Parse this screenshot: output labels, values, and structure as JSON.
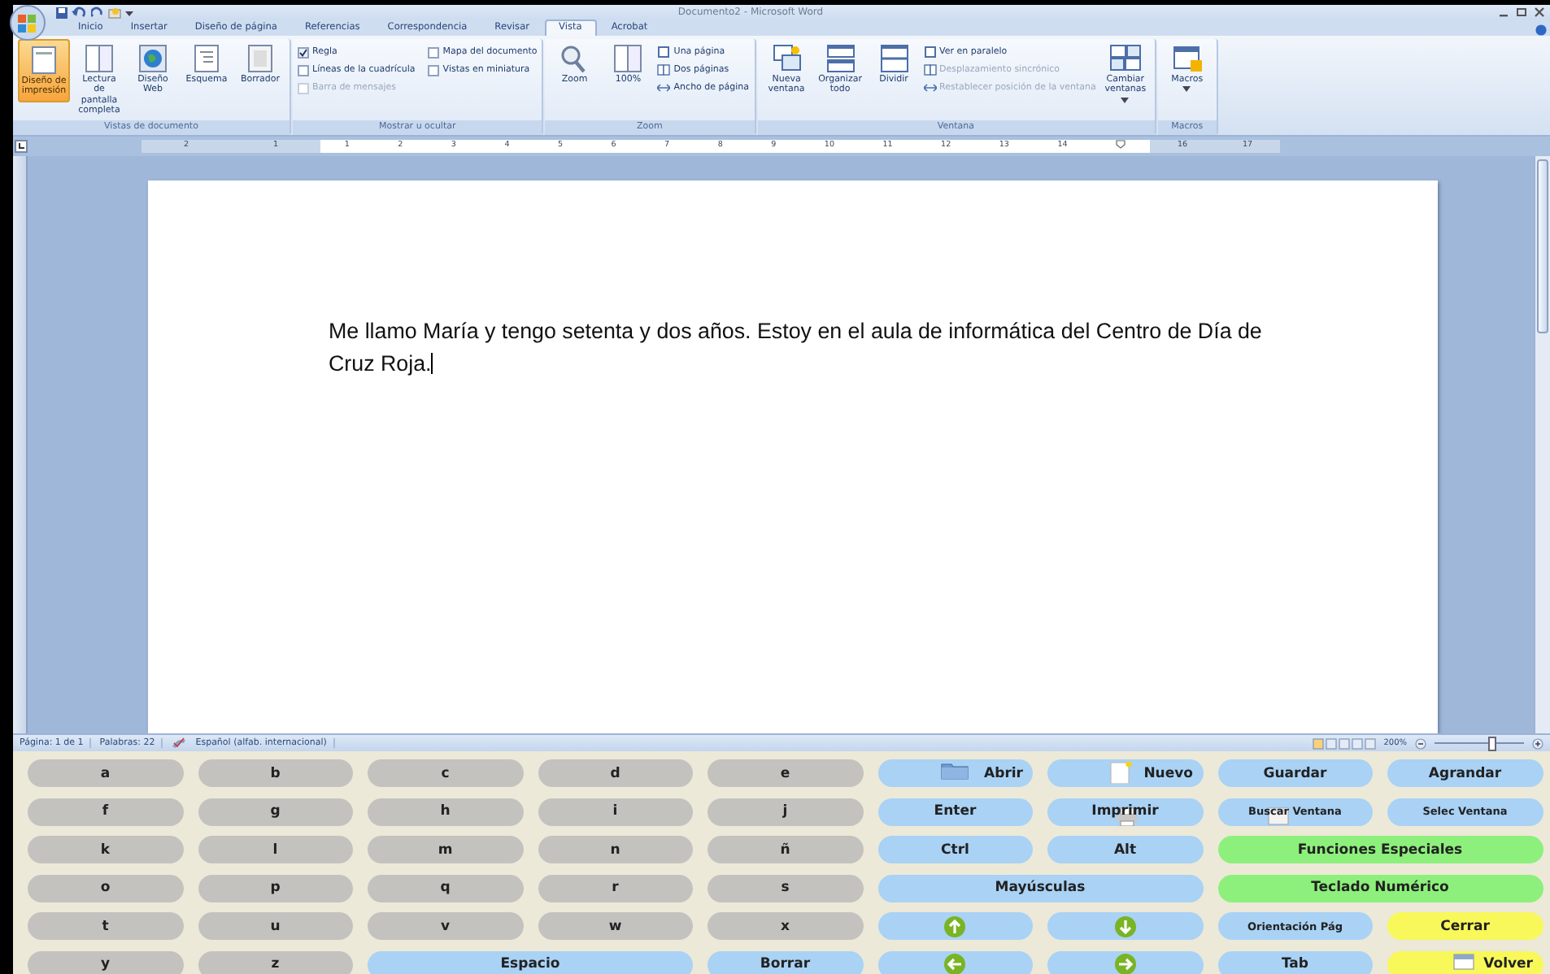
{
  "window": {
    "title": "Documento2 - Microsoft Word"
  },
  "tabs": [
    {
      "label": "Inicio",
      "selected": false
    },
    {
      "label": "Insertar",
      "selected": false
    },
    {
      "label": "Diseño de página",
      "selected": false
    },
    {
      "label": "Referencias",
      "selected": false
    },
    {
      "label": "Correspondencia",
      "selected": false
    },
    {
      "label": "Revisar",
      "selected": false
    },
    {
      "label": "Vista",
      "selected": true
    },
    {
      "label": "Acrobat",
      "selected": false
    }
  ],
  "ribbon": {
    "groups": [
      {
        "label": "Vistas de documento",
        "items": [
          {
            "kind": "large",
            "label": "Diseño de impresión",
            "selected": true
          },
          {
            "kind": "large",
            "label": "Lectura de pantalla completa",
            "selected": false
          },
          {
            "kind": "large",
            "label": "Diseño Web",
            "selected": false
          },
          {
            "kind": "large",
            "label": "Esquema",
            "selected": false
          },
          {
            "kind": "large",
            "label": "Borrador",
            "selected": false
          }
        ]
      },
      {
        "label": "Mostrar u ocultar",
        "items": [
          {
            "kind": "check",
            "label": "Regla",
            "checked": true,
            "disabled": false
          },
          {
            "kind": "check",
            "label": "Líneas de la cuadrícula",
            "checked": false,
            "disabled": false
          },
          {
            "kind": "check",
            "label": "Barra de mensajes",
            "checked": false,
            "disabled": true
          },
          {
            "kind": "check",
            "label": "Mapa del documento",
            "checked": false,
            "disabled": false
          },
          {
            "kind": "check",
            "label": "Vistas en miniatura",
            "checked": false,
            "disabled": false
          }
        ]
      },
      {
        "label": "Zoom",
        "items": [
          {
            "kind": "large",
            "label": "Zoom"
          },
          {
            "kind": "large",
            "label": "100%"
          },
          {
            "kind": "small",
            "label": "Una página",
            "disabled": false
          },
          {
            "kind": "small",
            "label": "Dos páginas",
            "disabled": false
          },
          {
            "kind": "small",
            "label": "Ancho de página",
            "disabled": false
          }
        ]
      },
      {
        "label": "Ventana",
        "items": [
          {
            "kind": "large",
            "label": "Nueva ventana"
          },
          {
            "kind": "large",
            "label": "Organizar todo"
          },
          {
            "kind": "large",
            "label": "Dividir"
          },
          {
            "kind": "small",
            "label": "Ver en paralelo",
            "disabled": false
          },
          {
            "kind": "small",
            "label": "Desplazamiento sincrónico",
            "disabled": true
          },
          {
            "kind": "small",
            "label": "Restablecer posición de la ventana",
            "disabled": true
          },
          {
            "kind": "dropdown",
            "label": "Cambiar ventanas"
          }
        ]
      },
      {
        "label": "Macros",
        "items": [
          {
            "kind": "dropdown",
            "label": "Macros"
          }
        ]
      }
    ]
  },
  "ruler": {
    "left_numbers": [
      "2",
      "1"
    ],
    "numbers": [
      "1",
      "2",
      "3",
      "4",
      "5",
      "6",
      "7",
      "8",
      "9",
      "10",
      "11",
      "12",
      "13",
      "14"
    ],
    "right_numbers": [
      "16",
      "17"
    ]
  },
  "document": {
    "paragraphs": [
      "Me llamo María y tengo setenta y dos años. Estoy en el aula de informática del Centro de Día de Cruz Roja."
    ]
  },
  "status_bar": {
    "pages": "Página: 1 de 1",
    "words": "Palabras: 22",
    "language": "Español (alfab. internacional)",
    "zoom": "200%",
    "zoom_slider": {
      "level": 0.62
    }
  },
  "keyboard": {
    "rows": [
      [
        {
          "label": "a",
          "color": "#c4c2bf"
        },
        {
          "label": "b",
          "color": "#c4c2bf"
        },
        {
          "label": "c",
          "color": "#c4c2bf"
        },
        {
          "label": "d",
          "color": "#c4c2bf"
        },
        {
          "label": "e",
          "color": "#c4c2bf"
        },
        {
          "kind": "open",
          "label": "Abrir",
          "color": "#a9d2f5"
        },
        {
          "kind": "new",
          "label": "Nuevo",
          "color": "#a9d2f5"
        },
        {
          "label": "Guardar",
          "color": "#a9d2f5"
        },
        {
          "label": "Agrandar",
          "color": "#a9d2f5"
        }
      ],
      [
        {
          "label": "f",
          "color": "#c4c2bf"
        },
        {
          "label": "g",
          "color": "#c4c2bf"
        },
        {
          "label": "h",
          "color": "#c4c2bf"
        },
        {
          "label": "i",
          "color": "#c4c2bf"
        },
        {
          "label": "j",
          "color": "#c4c2bf"
        },
        {
          "label": "Enter",
          "color": "#a9d2f5"
        },
        {
          "kind": "print",
          "label": "Imprimir",
          "color": "#a9d2f5"
        },
        {
          "kind": "find",
          "label": "Buscar Ventana",
          "small": true,
          "color": "#a9d2f5"
        },
        {
          "label": "Selec Ventana",
          "small": true,
          "color": "#a9d2f5"
        }
      ],
      [
        {
          "label": "k",
          "color": "#c4c2bf"
        },
        {
          "label": "l",
          "color": "#c4c2bf"
        },
        {
          "label": "m",
          "color": "#c4c2bf"
        },
        {
          "label": "n",
          "color": "#c4c2bf"
        },
        {
          "label": "ñ",
          "color": "#c4c2bf"
        },
        {
          "label": "Ctrl",
          "color": "#a9d2f5"
        },
        {
          "label": "Alt",
          "color": "#a9d2f5"
        },
        {
          "label": "Funciones Especiales",
          "colspan": 2,
          "color": "#8df07c"
        }
      ],
      [
        {
          "label": "o",
          "color": "#c4c2bf"
        },
        {
          "label": "p",
          "color": "#c4c2bf"
        },
        {
          "label": "q",
          "color": "#c4c2bf"
        },
        {
          "label": "r",
          "color": "#c4c2bf"
        },
        {
          "label": "s",
          "color": "#c4c2bf"
        },
        {
          "label": "Mayúsculas",
          "colspan": 2,
          "color": "#a9d2f5"
        },
        {
          "label": "Teclado Numérico",
          "colspan": 2,
          "color": "#8df07c"
        }
      ],
      [
        {
          "label": "t",
          "color": "#c4c2bf"
        },
        {
          "label": "u",
          "color": "#c4c2bf"
        },
        {
          "label": "v",
          "color": "#c4c2bf"
        },
        {
          "label": "w",
          "color": "#c4c2bf"
        },
        {
          "label": "x",
          "color": "#c4c2bf"
        },
        {
          "kind": "up",
          "color": "#a9d2f5"
        },
        {
          "kind": "down",
          "color": "#a9d2f5"
        },
        {
          "label": "Orientación Pág",
          "small": true,
          "color": "#a9d2f5"
        },
        {
          "label": "Cerrar",
          "color": "#f8f85a"
        }
      ],
      [
        {
          "label": "y",
          "color": "#c4c2bf"
        },
        {
          "label": "z",
          "color": "#c4c2bf"
        },
        {
          "label": "Espacio",
          "colspan": 2,
          "color": "#a9d2f5"
        },
        {
          "label": "Borrar",
          "color": "#a9d2f5"
        },
        {
          "kind": "left",
          "color": "#a9d2f5"
        },
        {
          "kind": "right",
          "color": "#a9d2f5"
        },
        {
          "label": "Tab",
          "color": "#a9d2f5"
        },
        {
          "kind": "back",
          "label": "Volver",
          "color": "#f8f85a"
        }
      ]
    ]
  }
}
